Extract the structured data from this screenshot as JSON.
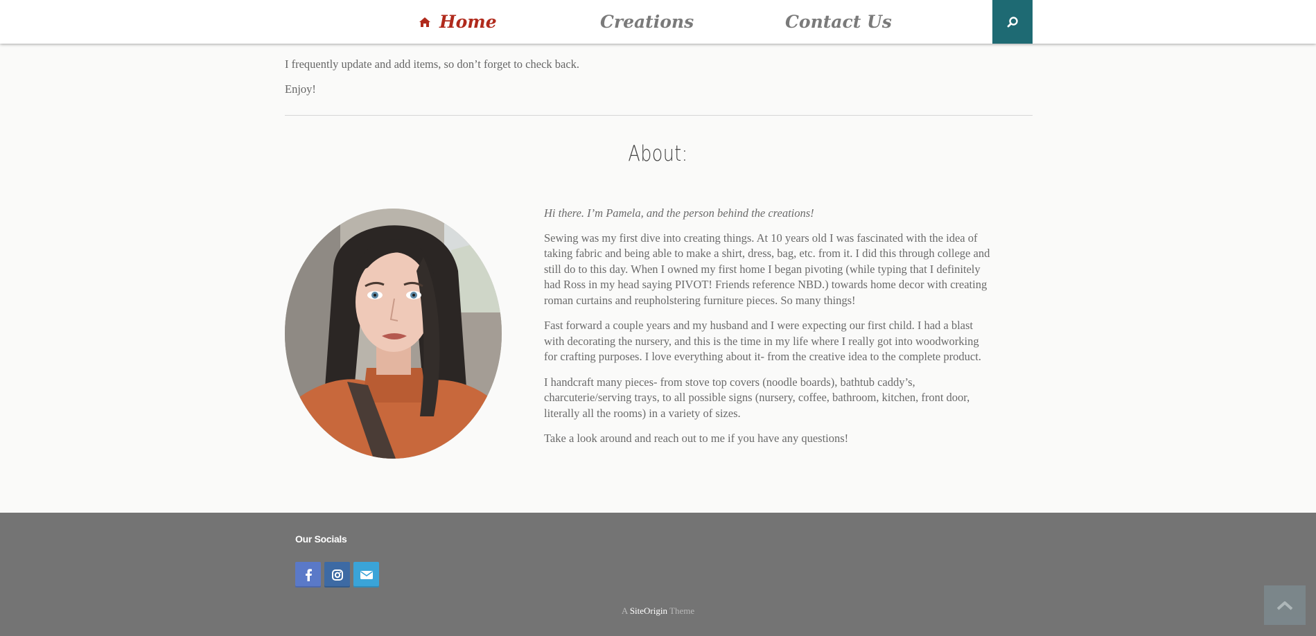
{
  "nav": {
    "home_label": "Home",
    "creations_label": "Creations",
    "contact_label": "Contact Us",
    "search_icon": "search-icon",
    "active_color": "#b02a1c",
    "search_bg": "#1e6a73"
  },
  "intro": {
    "line1": "I frequently update and add items, so don’t forget to check back.",
    "line2": "Enjoy!"
  },
  "about": {
    "title": "About:",
    "lead": "Hi there. I’m Pamela, and the person behind the creations!",
    "p1": "Sewing was my first dive into creating things. At 10 years old I was fascinated with the idea of taking fabric and being able to make a shirt, dress, bag, etc. from it. I did this through college and still do to this day. When I owned my first home I began pivoting (while typing that I definitely had Ross in my head saying PIVOT! Friends reference NBD.) towards home decor with creating roman curtains and reupholstering furniture pieces. So many things!",
    "p2": "Fast forward a couple years and my husband and I were expecting our first child. I had a blast with decorating the nursery, and this is the time in my life where I really got into woodworking for crafting purposes. I love everything about it- from the creative idea to the complete product.",
    "p3": "I handcraft many pieces- from stove top covers (noodle boards), bathtub caddy’s, charcuterie/serving trays, to all possible signs (nursery, coffee, bathroom, kitchen, front door, literally all the rooms) in a variety of sizes.",
    "p4": "Take a look around and reach out to me if you have any questions!"
  },
  "footer": {
    "heading": "Our Socials",
    "socials": [
      "facebook-icon",
      "instagram-icon",
      "envelope-icon"
    ],
    "credit_prefix": "A",
    "credit_brand": "SiteOrigin",
    "credit_suffix": "Theme"
  }
}
